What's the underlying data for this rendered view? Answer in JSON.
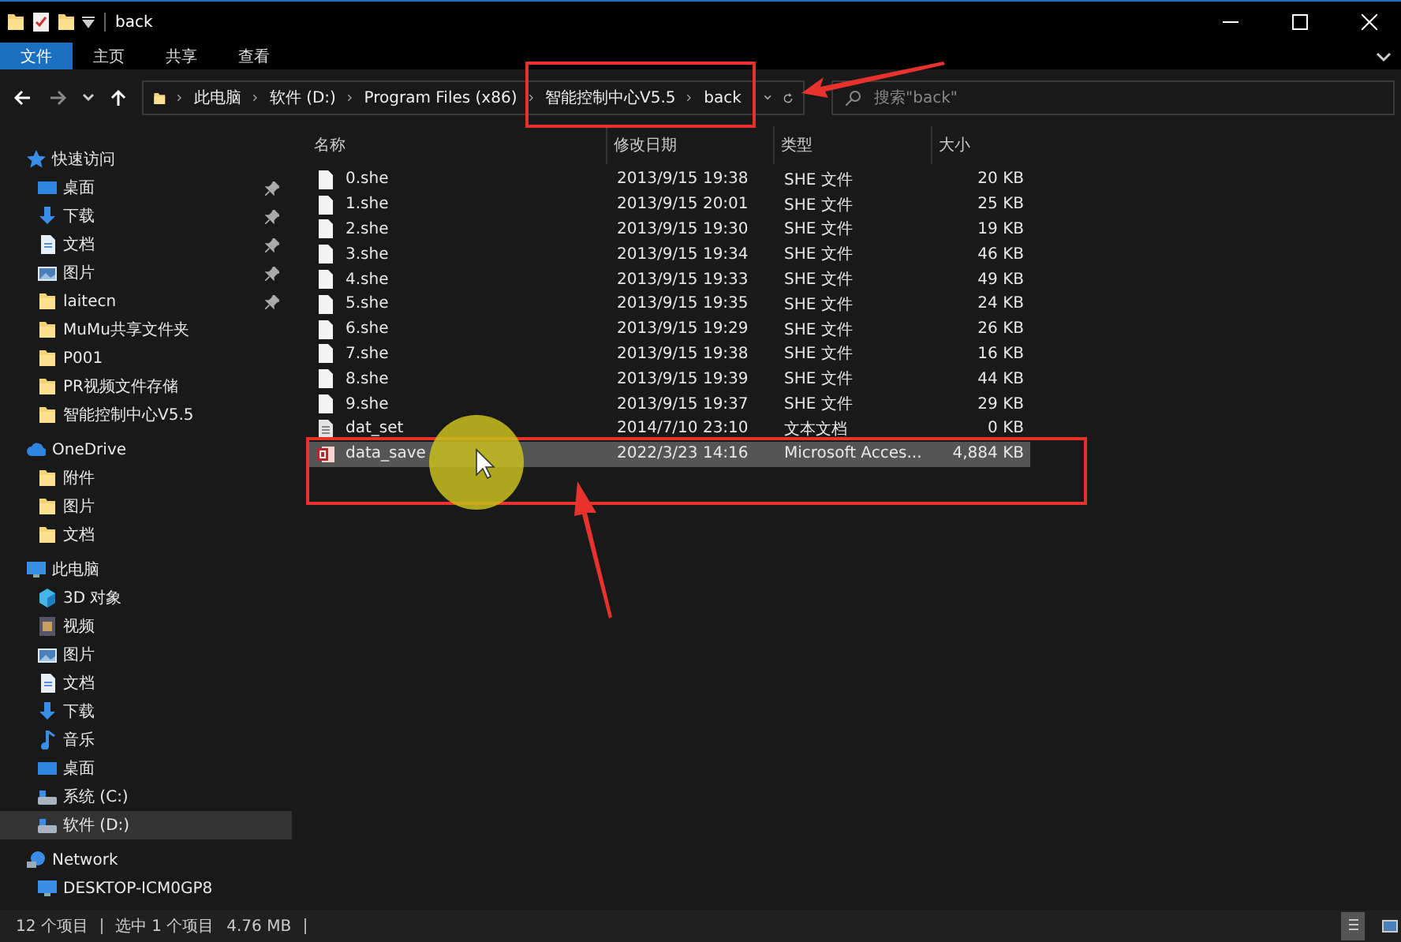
{
  "window": {
    "title": "back"
  },
  "ribbon_tabs": [
    {
      "label": "文件",
      "selected": true
    },
    {
      "label": "主页",
      "selected": false
    },
    {
      "label": "共享",
      "selected": false
    },
    {
      "label": "查看",
      "selected": false
    }
  ],
  "address": {
    "crumbs": [
      "此电脑",
      "软件 (D:)",
      "Program Files (x86)",
      "智能控制中心V5.5",
      "back"
    ]
  },
  "search": {
    "placeholder": "搜索\"back\""
  },
  "sidebar": [
    {
      "label": "快速访问",
      "kind": "star",
      "selected": false,
      "children": [
        {
          "label": "桌面",
          "kind": "desktop",
          "pinned": true,
          "selected": false
        },
        {
          "label": "下载",
          "kind": "download",
          "pinned": true,
          "selected": false
        },
        {
          "label": "文档",
          "kind": "document",
          "pinned": true,
          "selected": false
        },
        {
          "label": "图片",
          "kind": "picture",
          "pinned": true,
          "selected": false
        },
        {
          "label": "laitecn",
          "kind": "folder",
          "pinned": true,
          "selected": false
        },
        {
          "label": "MuMu共享文件夹",
          "kind": "folder",
          "pinned": false,
          "selected": false
        },
        {
          "label": "P001",
          "kind": "folder",
          "pinned": false,
          "selected": false
        },
        {
          "label": "PR视频文件存储",
          "kind": "folder",
          "pinned": false,
          "selected": false
        },
        {
          "label": "智能控制中心V5.5",
          "kind": "folder",
          "pinned": false,
          "selected": false
        }
      ]
    },
    {
      "label": "OneDrive",
      "kind": "cloud",
      "selected": false,
      "children": [
        {
          "label": "附件",
          "kind": "folder",
          "pinned": false,
          "selected": false
        },
        {
          "label": "图片",
          "kind": "folder",
          "pinned": false,
          "selected": false
        },
        {
          "label": "文档",
          "kind": "folder",
          "pinned": false,
          "selected": false
        }
      ]
    },
    {
      "label": "此电脑",
      "kind": "pc",
      "selected": false,
      "children": [
        {
          "label": "3D 对象",
          "kind": "cube",
          "pinned": false,
          "selected": false
        },
        {
          "label": "视频",
          "kind": "video",
          "pinned": false,
          "selected": false
        },
        {
          "label": "图片",
          "kind": "picture",
          "pinned": false,
          "selected": false
        },
        {
          "label": "文档",
          "kind": "document",
          "pinned": false,
          "selected": false
        },
        {
          "label": "下载",
          "kind": "download",
          "pinned": false,
          "selected": false
        },
        {
          "label": "音乐",
          "kind": "music",
          "pinned": false,
          "selected": false
        },
        {
          "label": "桌面",
          "kind": "desktop",
          "pinned": false,
          "selected": false
        },
        {
          "label": "系统 (C:)",
          "kind": "drive",
          "pinned": false,
          "selected": false
        },
        {
          "label": "软件 (D:)",
          "kind": "drive",
          "pinned": false,
          "selected": true
        }
      ]
    },
    {
      "label": "Network",
      "kind": "network",
      "selected": false,
      "children": [
        {
          "label": "DESKTOP-ICM0GP8",
          "kind": "pc",
          "pinned": false,
          "selected": false
        }
      ]
    }
  ],
  "columns": [
    "名称",
    "修改日期",
    "类型",
    "大小"
  ],
  "rows": [
    {
      "name": "0.she",
      "date": "2013/9/15 19:38",
      "type": "SHE 文件",
      "size": "20 KB",
      "kind": "blank",
      "selected": false
    },
    {
      "name": "1.she",
      "date": "2013/9/15 20:01",
      "type": "SHE 文件",
      "size": "25 KB",
      "kind": "blank",
      "selected": false
    },
    {
      "name": "2.she",
      "date": "2013/9/15 19:30",
      "type": "SHE 文件",
      "size": "19 KB",
      "kind": "blank",
      "selected": false
    },
    {
      "name": "3.she",
      "date": "2013/9/15 19:34",
      "type": "SHE 文件",
      "size": "46 KB",
      "kind": "blank",
      "selected": false
    },
    {
      "name": "4.she",
      "date": "2013/9/15 19:33",
      "type": "SHE 文件",
      "size": "49 KB",
      "kind": "blank",
      "selected": false
    },
    {
      "name": "5.she",
      "date": "2013/9/15 19:35",
      "type": "SHE 文件",
      "size": "24 KB",
      "kind": "blank",
      "selected": false
    },
    {
      "name": "6.she",
      "date": "2013/9/15 19:29",
      "type": "SHE 文件",
      "size": "26 KB",
      "kind": "blank",
      "selected": false
    },
    {
      "name": "7.she",
      "date": "2013/9/15 19:38",
      "type": "SHE 文件",
      "size": "16 KB",
      "kind": "blank",
      "selected": false
    },
    {
      "name": "8.she",
      "date": "2013/9/15 19:39",
      "type": "SHE 文件",
      "size": "44 KB",
      "kind": "blank",
      "selected": false
    },
    {
      "name": "9.she",
      "date": "2013/9/15 19:37",
      "type": "SHE 文件",
      "size": "29 KB",
      "kind": "blank",
      "selected": false
    },
    {
      "name": "dat_set",
      "date": "2014/7/10 23:10",
      "type": "文本文档",
      "size": "0 KB",
      "kind": "text",
      "selected": false
    },
    {
      "name": "data_save",
      "date": "2022/3/23 14:16",
      "type": "Microsoft Acces...",
      "size": "4,884 KB",
      "kind": "access",
      "selected": true
    }
  ],
  "status_bar": {
    "count": "12 个项目",
    "selection": "选中 1 个项目",
    "selection_size": "4.76 MB"
  }
}
